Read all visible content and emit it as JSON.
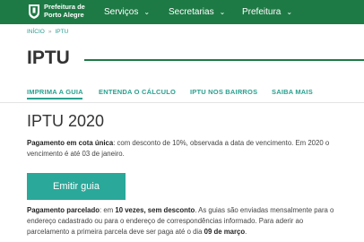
{
  "header": {
    "brand_line1": "Prefeitura de",
    "brand_line2": "Porto Alegre",
    "nav": [
      {
        "label": "Serviços"
      },
      {
        "label": "Secretarias"
      },
      {
        "label": "Prefeitura"
      }
    ]
  },
  "breadcrumb": {
    "home": "INÍCIO",
    "separator": "»",
    "current": "IPTU"
  },
  "page": {
    "title": "IPTU"
  },
  "tabs": [
    {
      "label": "IMPRIMA A GUIA"
    },
    {
      "label": "ENTENDA O CÁLCULO"
    },
    {
      "label": "IPTU NOS BAIRROS"
    },
    {
      "label": "SAIBA MAIS"
    }
  ],
  "content": {
    "section_title": "IPTU 2020",
    "p1_label": "Pagamento em cota única",
    "p1_text": ": com desconto de 10%, observada a data de vencimento. Em 2020 o vencimento é até 03 de janeiro.",
    "button": "Emitir guia",
    "p2_label": "Pagamento parcelado",
    "p2_colon": ": em ",
    "p2_bold1": "10 vezes, sem desconto",
    "p2_text": ". As guias são enviadas mensalmente para o endereço cadastrado ou para o endereço de correspondências informado. Para aderir ao parcelamento a primeira parcela deve ser paga até o dia ",
    "p2_bold2": "09 de março",
    "p2_end": "."
  },
  "colors": {
    "header": "#1e7a45",
    "accent": "#2aa899"
  }
}
